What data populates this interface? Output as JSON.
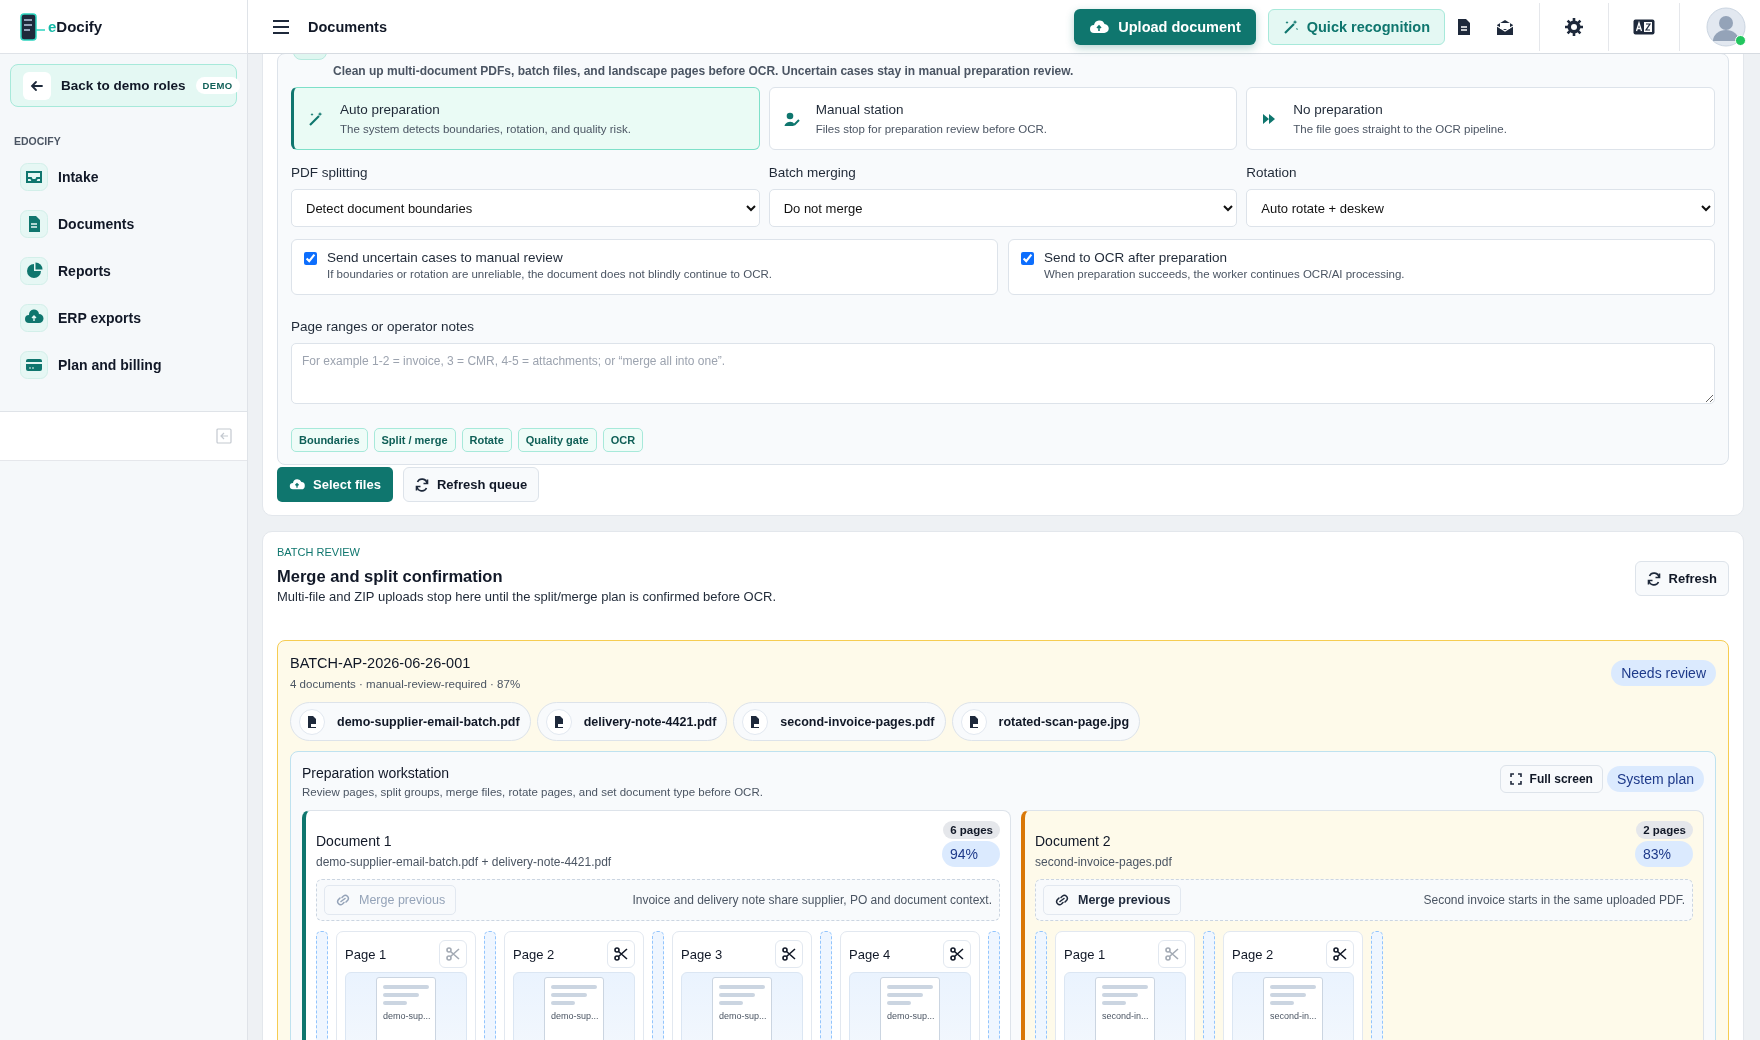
{
  "brand": {
    "accent": "e",
    "rest": "Docify"
  },
  "sidebar": {
    "back_label": "Back to demo roles",
    "back_badge": "DEMO",
    "section": "EDOCIFY",
    "items": [
      {
        "label": "Intake",
        "selected": false
      },
      {
        "label": "Documents",
        "selected": false
      },
      {
        "label": "Reports",
        "selected": false
      },
      {
        "label": "ERP exports",
        "selected": false
      },
      {
        "label": "Plan and billing",
        "selected": false
      }
    ]
  },
  "topbar": {
    "title": "Documents",
    "upload": "Upload document",
    "quick": "Quick recognition"
  },
  "prep": {
    "description": "Clean up multi-document PDFs, batch files, and landscape pages before OCR. Uncertain cases stay in manual preparation review.",
    "modes": [
      {
        "title": "Auto preparation",
        "text": "The system detects boundaries, rotation, and quality risk.",
        "selected": true
      },
      {
        "title": "Manual station",
        "text": "Files stop for preparation review before OCR.",
        "selected": false
      },
      {
        "title": "No preparation",
        "text": "The file goes straight to the OCR pipeline.",
        "selected": false
      }
    ],
    "fields": [
      {
        "label": "PDF splitting",
        "value": "Detect document boundaries"
      },
      {
        "label": "Batch merging",
        "value": "Do not merge"
      },
      {
        "label": "Rotation",
        "value": "Auto rotate + deskew"
      }
    ],
    "options": [
      {
        "title": "Send uncertain cases to manual review",
        "text": "If boundaries or rotation are unreliable, the document does not blindly continue to OCR.",
        "checked": true
      },
      {
        "title": "Send to OCR after preparation",
        "text": "When preparation succeeds, the worker continues OCR/AI processing.",
        "checked": true
      }
    ],
    "notes": {
      "label": "Page ranges or operator notes",
      "placeholder": "For example 1-2 = invoice, 3 = CMR, 4-5 = attachments; or “merge all into one”."
    },
    "tags": [
      "Boundaries",
      "Split / merge",
      "Rotate",
      "Quality gate",
      "OCR"
    ],
    "select_button": "Select files",
    "refresh_button": "Refresh queue"
  },
  "batch_review": {
    "eyebrow": "BATCH REVIEW",
    "title": "Merge and split confirmation",
    "text": "Multi-file and ZIP uploads stop here until the split/merge plan is confirmed before OCR.",
    "refresh": "Refresh"
  },
  "batch": {
    "id": "BATCH-AP-2026-06-26-001",
    "meta": "4 documents · manual-review-required · 87%",
    "status": "Needs review",
    "files": [
      "demo-supplier-email-batch.pdf",
      "delivery-note-4421.pdf",
      "second-invoice-pages.pdf",
      "rotated-scan-page.jpg"
    ],
    "workstation": {
      "title": "Preparation workstation",
      "text": "Review pages, split groups, merge files, rotate pages, and set document type before OCR.",
      "fullscreen": "Full screen",
      "plan": "System plan",
      "documents": [
        {
          "title": "Document 1",
          "files": "demo-supplier-email-batch.pdf + delivery-note-4421.pdf",
          "pages_badge": "6 pages",
          "confidence": "94%",
          "color": "#0f766e",
          "merge_label": "Merge previous",
          "merge_disabled": true,
          "note": "Invoice and delivery note share supplier, PO and document context.",
          "pages": [
            {
              "label": "Page 1",
              "thumb": "demo-sup...",
              "split_disabled": true
            },
            {
              "label": "Page 2",
              "thumb": "demo-sup...",
              "split_disabled": false
            },
            {
              "label": "Page 3",
              "thumb": "demo-sup...",
              "split_disabled": false
            },
            {
              "label": "Page 4",
              "thumb": "demo-sup...",
              "split_disabled": false
            }
          ]
        },
        {
          "title": "Document 2",
          "files": "second-invoice-pages.pdf",
          "pages_badge": "2 pages",
          "confidence": "83%",
          "color": "#d97706",
          "merge_label": "Merge previous",
          "merge_disabled": false,
          "note": "Second invoice starts in the same uploaded PDF.",
          "pages": [
            {
              "label": "Page 1",
              "thumb": "second-in...",
              "split_disabled": true
            },
            {
              "label": "Page 2",
              "thumb": "second-in...",
              "split_disabled": false
            }
          ]
        }
      ]
    }
  }
}
